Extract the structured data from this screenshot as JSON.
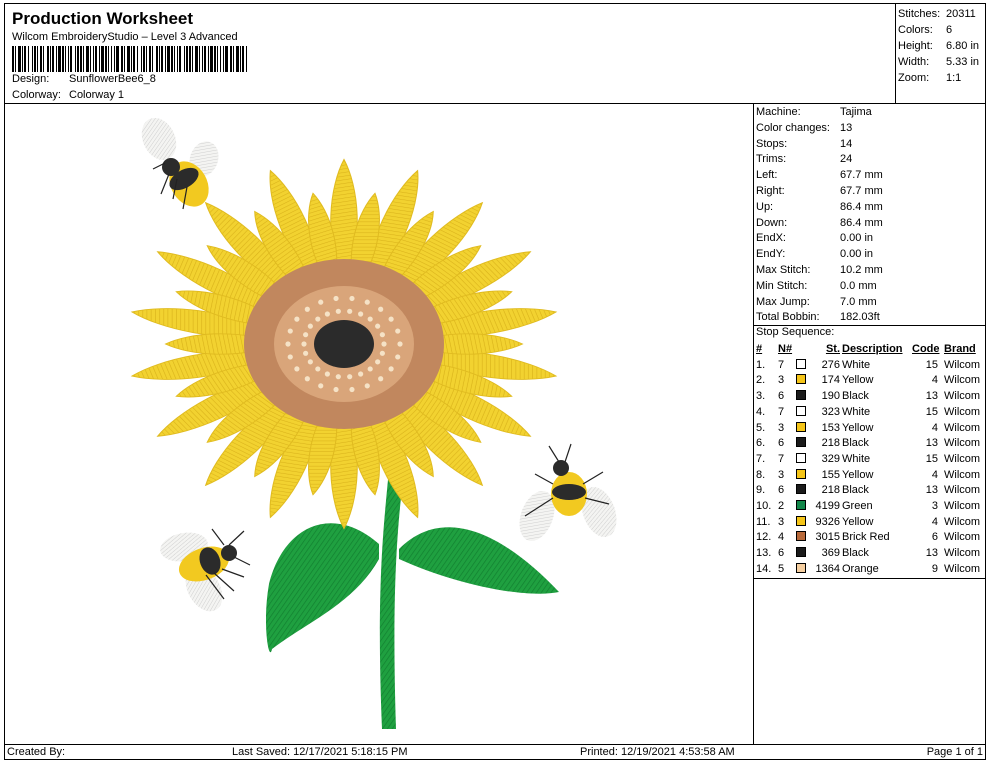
{
  "header": {
    "title": "Production Worksheet",
    "subtitle": "Wilcom EmbroideryStudio – Level 3 Advanced",
    "design_label": "Design:",
    "design_value": "SunflowerBee6_8",
    "colorway_label": "Colorway:",
    "colorway_value": "Colorway 1"
  },
  "stats": [
    {
      "label": "Stitches:",
      "value": "20311"
    },
    {
      "label": "Colors:",
      "value": "6"
    },
    {
      "label": "Height:",
      "value": "6.80 in"
    },
    {
      "label": "Width:",
      "value": "5.33 in"
    },
    {
      "label": "Zoom:",
      "value": "1:1"
    }
  ],
  "machine": [
    {
      "label": "Machine:",
      "value": "Tajima"
    },
    {
      "label": "Color changes:",
      "value": "13"
    },
    {
      "label": "Stops:",
      "value": "14"
    },
    {
      "label": "Trims:",
      "value": "24"
    },
    {
      "label": "Left:",
      "value": "67.7 mm"
    },
    {
      "label": "Right:",
      "value": "67.7 mm"
    },
    {
      "label": "Up:",
      "value": "86.4 mm"
    },
    {
      "label": "Down:",
      "value": "86.4 mm"
    },
    {
      "label": "EndX:",
      "value": "0.00 in"
    },
    {
      "label": "EndY:",
      "value": "0.00 in"
    },
    {
      "label": "Max Stitch:",
      "value": "10.2 mm"
    },
    {
      "label": "Min Stitch:",
      "value": "0.0 mm"
    },
    {
      "label": "Max Jump:",
      "value": "7.0 mm"
    },
    {
      "label": "Total Bobbin:",
      "value": "182.03ft"
    }
  ],
  "stop_sequence": {
    "title": "Stop Sequence:",
    "headers": {
      "num": "#",
      "n": "N#",
      "st": "St.",
      "description": "Description",
      "code": "Code",
      "brand": "Brand"
    },
    "rows": [
      {
        "num": "1.",
        "n": "7",
        "color": "#ffffff",
        "st": "276",
        "description": "White",
        "code": "15",
        "brand": "Wilcom"
      },
      {
        "num": "2.",
        "n": "3",
        "color": "#f5c518",
        "st": "174",
        "description": "Yellow",
        "code": "4",
        "brand": "Wilcom"
      },
      {
        "num": "3.",
        "n": "6",
        "color": "#1a1a1a",
        "st": "190",
        "description": "Black",
        "code": "13",
        "brand": "Wilcom"
      },
      {
        "num": "4.",
        "n": "7",
        "color": "#ffffff",
        "st": "323",
        "description": "White",
        "code": "15",
        "brand": "Wilcom"
      },
      {
        "num": "5.",
        "n": "3",
        "color": "#f5c518",
        "st": "153",
        "description": "Yellow",
        "code": "4",
        "brand": "Wilcom"
      },
      {
        "num": "6.",
        "n": "6",
        "color": "#1a1a1a",
        "st": "218",
        "description": "Black",
        "code": "13",
        "brand": "Wilcom"
      },
      {
        "num": "7.",
        "n": "7",
        "color": "#ffffff",
        "st": "329",
        "description": "White",
        "code": "15",
        "brand": "Wilcom"
      },
      {
        "num": "8.",
        "n": "3",
        "color": "#f5c518",
        "st": "155",
        "description": "Yellow",
        "code": "4",
        "brand": "Wilcom"
      },
      {
        "num": "9.",
        "n": "6",
        "color": "#1a1a1a",
        "st": "218",
        "description": "Black",
        "code": "13",
        "brand": "Wilcom"
      },
      {
        "num": "10.",
        "n": "2",
        "color": "#12874a",
        "st": "4199",
        "description": "Green",
        "code": "3",
        "brand": "Wilcom"
      },
      {
        "num": "11.",
        "n": "3",
        "color": "#f5c518",
        "st": "9326",
        "description": "Yellow",
        "code": "4",
        "brand": "Wilcom"
      },
      {
        "num": "12.",
        "n": "4",
        "color": "#b8693a",
        "st": "3015",
        "description": "Brick Red",
        "code": "6",
        "brand": "Wilcom"
      },
      {
        "num": "13.",
        "n": "6",
        "color": "#1a1a1a",
        "st": "369",
        "description": "Black",
        "code": "13",
        "brand": "Wilcom"
      },
      {
        "num": "14.",
        "n": "5",
        "color": "#f6cfa0",
        "st": "1364",
        "description": "Orange",
        "code": "9",
        "brand": "Wilcom"
      }
    ]
  },
  "footer": {
    "created_by": "Created By:",
    "last_saved": "Last Saved: 12/17/2021 5:18:15 PM",
    "printed": "Printed: 12/19/2021 4:53:58 AM",
    "page": "Page 1 of 1"
  }
}
